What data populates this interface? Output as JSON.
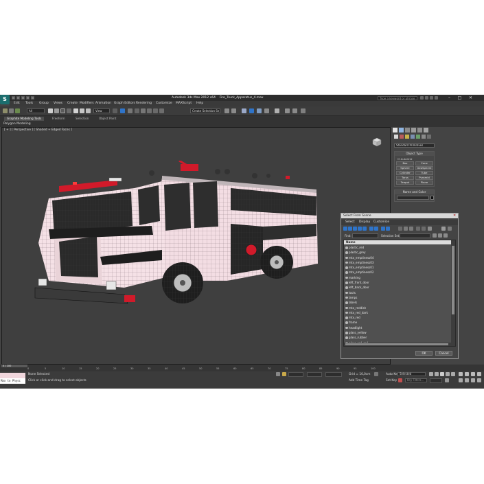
{
  "app": {
    "logo": "S",
    "title": "Autodesk 3ds Max 2012 x64",
    "file": "Fire_Truck_Apparatus_4.max",
    "help_search_placeholder": "Type a keyword or phrase",
    "minimize": "–",
    "maximize": "□",
    "close": "✕"
  },
  "menu": [
    "Edit",
    "Tools",
    "Group",
    "Views",
    "Create",
    "Modifiers",
    "Animation",
    "Graph Editors",
    "Rendering",
    "Customize",
    "MAXScript",
    "Help"
  ],
  "toolbar": {
    "selection_filter": "All",
    "reference_coord": "View",
    "named_selection": "Create Selection Se"
  },
  "ribbon": {
    "tabs": [
      "Graphite Modeling Tools",
      "Freeform",
      "Selection",
      "Object Paint"
    ],
    "active_tab": 0,
    "sub_label": "Polygon Modeling"
  },
  "viewport": {
    "label": "[ + ] [ Perspective ] [ Shaded + Edged Faces ]"
  },
  "command_panel": {
    "category": "Standard Primitives",
    "object_type_title": "Object Type",
    "autogrid_label": "AutoGrid",
    "primitives": [
      "Box",
      "Cone",
      "Sphere",
      "GeoSphere",
      "Cylinder",
      "Tube",
      "Torus",
      "Pyramid",
      "Teapot",
      "Plane"
    ],
    "name_color_title": "Name and Color"
  },
  "select_dialog": {
    "title": "Select From Scene",
    "close": "✕",
    "menu": [
      "Select",
      "Display",
      "Customize"
    ],
    "active_menu": 0,
    "find_label": "Find:",
    "selection_set_label": "Selection Set:",
    "column_header": "Name",
    "items": [
      "plastic_red",
      "plastic_grey",
      "mtx_emptiness04",
      "mtx_emptiness03",
      "mtx_emptiness01",
      "mtx_emptiness02",
      "marking",
      "left_front_door",
      "left_back_door",
      "tools",
      "lamps",
      "labels",
      "mtx_reddish",
      "mtx_red_dark",
      "mtx_red",
      "frame",
      "headlight",
      "glass_yellow",
      "glass_rubber",
      "glass_red_red"
    ],
    "ok": "OK",
    "cancel": "Cancel"
  },
  "status": {
    "time_slider": "0 / 100",
    "ticks": [
      "0",
      "5",
      "10",
      "15",
      "20",
      "25",
      "30",
      "35",
      "40",
      "45",
      "50",
      "55",
      "60",
      "65",
      "70",
      "75",
      "80",
      "85",
      "90",
      "95",
      "100"
    ],
    "maxscript_output": "Max to Physc",
    "selection_status": "None Selected",
    "prompt": "Click or click-and-drag to select objects",
    "grid": "Grid = 10,0cm",
    "add_time_tag": "Add Time Tag",
    "auto_key_label": "Auto Key",
    "auto_key_value": "Selected",
    "set_key_label": "Set Key",
    "key_filters": "Key Filters..."
  },
  "colors": {
    "accent_blue": "#2f74c9",
    "truck_pink": "#f3dde3",
    "truck_red": "#d11a2a",
    "wireframe": "#555555"
  }
}
